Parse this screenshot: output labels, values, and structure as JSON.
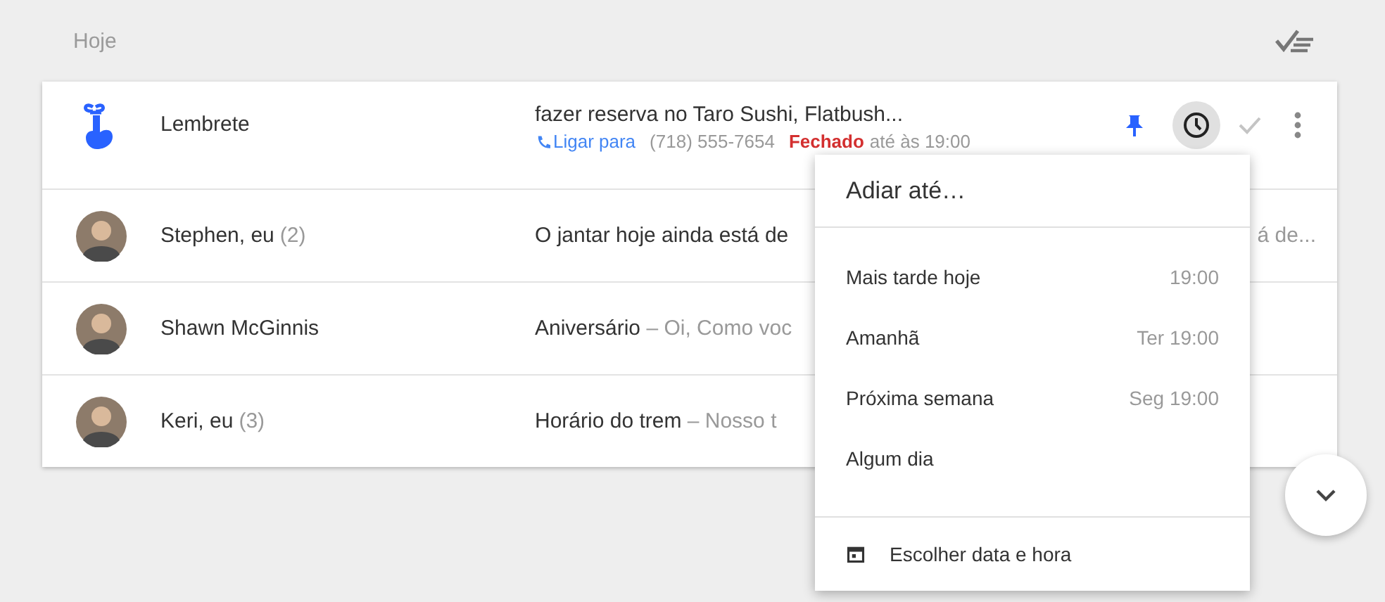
{
  "section": {
    "title": "Hoje"
  },
  "rows": [
    {
      "kind": "reminder",
      "name": "Lembrete",
      "subject": "fazer reserva no Taro Sushi, Flatbush...",
      "call_link": "Ligar para",
      "phone": "(718) 555-7654",
      "status": "Fechado",
      "hours": "até às 19:00",
      "actions": [
        {
          "kind": "pin",
          "on": true
        },
        {
          "kind": "snooze",
          "selected": true
        },
        {
          "kind": "done",
          "selected": false
        },
        {
          "kind": "more",
          "selected": false
        }
      ]
    },
    {
      "kind": "thread",
      "name": "Stephen, eu",
      "count": "(2)",
      "subject": "O jantar hoje ainda está de",
      "tail": "á de..."
    },
    {
      "kind": "thread",
      "name": "Shawn McGinnis",
      "subject": "Aniversário",
      "snippet": " – Oi, Como voc"
    },
    {
      "kind": "thread",
      "name": "Keri, eu",
      "count": "(3)",
      "subject": "Horário do trem",
      "snippet": " – Nosso t"
    }
  ],
  "snooze_menu": {
    "title": "Adiar até…",
    "options": [
      {
        "label": "Mais tarde hoje",
        "time": "19:00"
      },
      {
        "label": "Amanhã",
        "time": "Ter 19:00"
      },
      {
        "label": "Próxima semana",
        "time": "Seg 19:00"
      },
      {
        "label": "Algum dia"
      }
    ],
    "custom": "Escolher data e hora"
  }
}
